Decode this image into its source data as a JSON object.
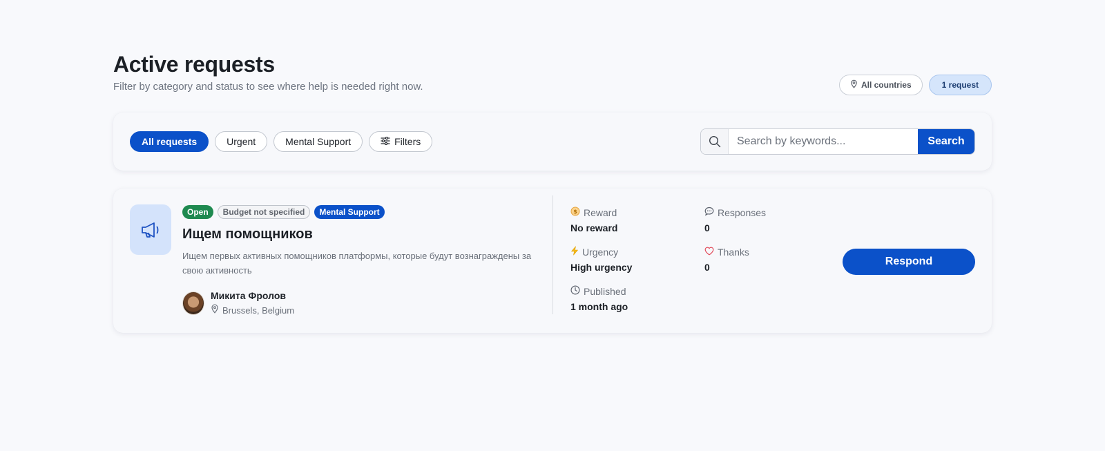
{
  "header": {
    "title": "Active requests",
    "subtitle": "Filter by category and status to see where help is needed right now.",
    "country_chip": "All countries",
    "count_chip": "1 request"
  },
  "filters": {
    "pills": [
      {
        "label": "All requests",
        "active": true
      },
      {
        "label": "Urgent",
        "active": false
      },
      {
        "label": "Mental Support",
        "active": false
      },
      {
        "label": "Filters",
        "active": false,
        "icon": "sliders-icon"
      }
    ],
    "search": {
      "placeholder": "Search by keywords...",
      "value": "",
      "button_label": "Search"
    }
  },
  "request": {
    "icon": "megaphone-icon",
    "badges": {
      "status": "Open",
      "budget": "Budget not specified",
      "category": "Mental Support"
    },
    "title": "Ищем помощников",
    "description": "Ищем первых активных помощников платформы, которые будут вознаграждены за свою активность",
    "author": {
      "name": "Микита Фролов",
      "location": "Brussels, Belgium"
    },
    "stats": {
      "reward": {
        "label": "Reward",
        "value": "No reward",
        "icon": "coin-icon"
      },
      "responses": {
        "label": "Responses",
        "value": "0",
        "icon": "chat-bubble-icon"
      },
      "urgency": {
        "label": "Urgency",
        "value": "High urgency",
        "icon": "lightning-icon"
      },
      "thanks": {
        "label": "Thanks",
        "value": "0",
        "icon": "heart-icon"
      },
      "published": {
        "label": "Published",
        "value": "1 month ago",
        "icon": "clock-icon"
      }
    },
    "respond_label": "Respond"
  },
  "colors": {
    "primary": "#0b51c9",
    "open_green": "#1f8a50",
    "accent_light": "#d4e3fb"
  }
}
